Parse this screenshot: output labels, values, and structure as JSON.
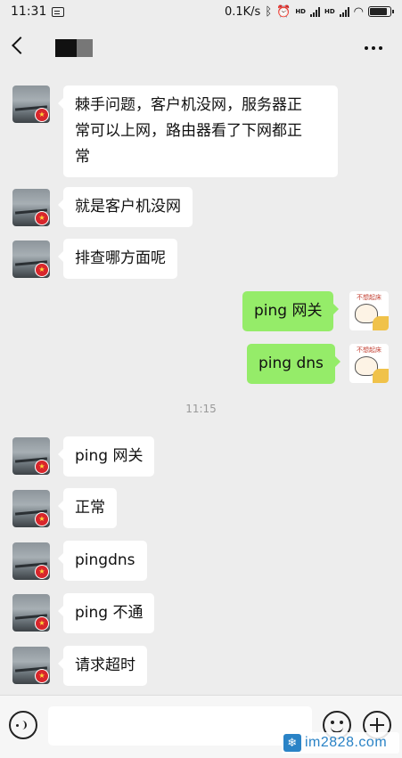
{
  "status_bar": {
    "time": "11:31",
    "speed": "0.1K/s",
    "network1": "HD",
    "network2": "HD"
  },
  "header": {
    "menu_icon": "more-dots-icon",
    "back_icon": "back-chevron-icon"
  },
  "messages": [
    {
      "side": "left",
      "text": "棘手问题，客户机没网，服务器正常可以上网，路由器看了下网都正常"
    },
    {
      "side": "left",
      "text": "就是客户机没网"
    },
    {
      "side": "left",
      "text": "排查哪方面呢"
    },
    {
      "side": "right",
      "text": "ping 网关"
    },
    {
      "side": "right",
      "text": "ping dns"
    },
    {
      "side": "left",
      "text": "ping 网关"
    },
    {
      "side": "left",
      "text": "正常"
    },
    {
      "side": "left",
      "text": "pingdns"
    },
    {
      "side": "left",
      "text": "ping 不通"
    },
    {
      "side": "left",
      "text": "请求超时"
    }
  ],
  "timestamp": "11:15",
  "sticker_caption": "不想起床",
  "message_line2": "常可以上网，路由器看了下网都正",
  "message_line3": "常",
  "message_line1": "棘手问题，客户机没网，服务器正",
  "input": {
    "placeholder": ""
  },
  "watermark": "im2828.com",
  "colors": {
    "self_bubble": "#95ec69",
    "other_bubble": "#ffffff",
    "background": "#ededed"
  }
}
